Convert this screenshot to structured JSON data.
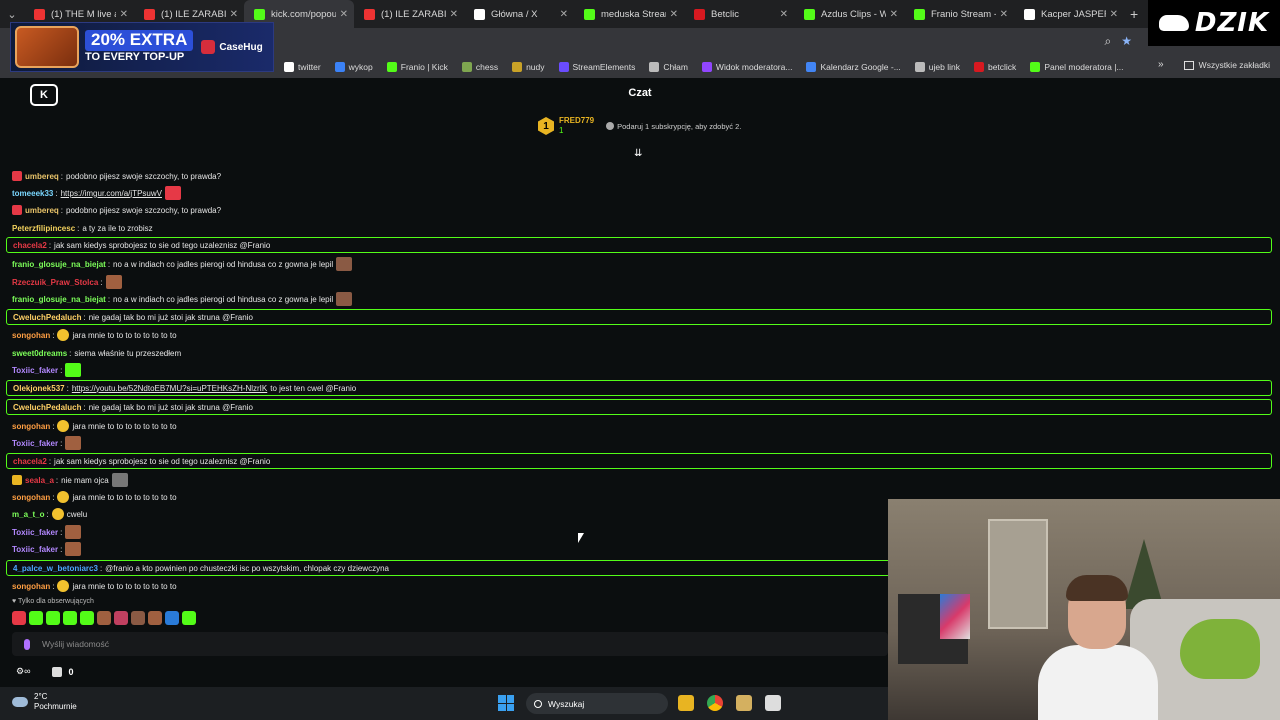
{
  "browser": {
    "tabs": [
      {
        "label": "(1) THE M live at R",
        "color": "#e33"
      },
      {
        "label": "(1) ILE ZARABIA K",
        "color": "#e33"
      },
      {
        "label": "kick.com/popout/",
        "color": "#53fc18",
        "active": true
      },
      {
        "label": "(1) ILE ZARABIA K",
        "color": "#e33"
      },
      {
        "label": "Główna / X",
        "color": "#fff"
      },
      {
        "label": "meduska Stream",
        "color": "#53fc18"
      },
      {
        "label": "Betclic",
        "color": "#d71920"
      },
      {
        "label": "Azdus Clips - Wat",
        "color": "#53fc18"
      },
      {
        "label": "Franio Stream - W",
        "color": "#53fc18"
      },
      {
        "label": "Kacper JASPER P",
        "color": "#fff"
      }
    ],
    "close_glyph": "✕",
    "new_tab_glyph": "+",
    "bookmarks": [
      {
        "label": "twitter",
        "color": "#fff"
      },
      {
        "label": "wykop",
        "color": "#3b82f6"
      },
      {
        "label": "Franio | Kick",
        "color": "#53fc18"
      },
      {
        "label": "chess",
        "color": "#7fa650"
      },
      {
        "label": "nudy",
        "color": "#c9a227"
      },
      {
        "label": "StreamElements",
        "color": "#6a4cff"
      },
      {
        "label": "Chłam",
        "color": "#bbb"
      },
      {
        "label": "Widok moderatora...",
        "color": "#9146ff"
      },
      {
        "label": "Kalendarz Google -...",
        "color": "#4285f4"
      },
      {
        "label": "ujeb link",
        "color": "#bbb"
      },
      {
        "label": "betclick",
        "color": "#d71920"
      },
      {
        "label": "Panel moderatora |...",
        "color": "#53fc18"
      }
    ],
    "all_bookmarks": "Wszystkie zakładki"
  },
  "ad": {
    "headline": "20% EXTRA",
    "subline": "TO EVERY TOP-UP",
    "brand": "CaseHug"
  },
  "overlay_logo": "DZIK",
  "chat": {
    "title": "Czat",
    "pinned": {
      "rank": "1",
      "name": "FRED779",
      "count": "1",
      "gift_text": "Podaruj 1 subskrypcję, aby zdobyć 2."
    },
    "messages": [
      {
        "user": "umbereq",
        "color": "#e9c46a",
        "text": "podobno pijesz swoje szczochy, to prawda?",
        "badge": "#e63946"
      },
      {
        "user": "tomeeek33",
        "color": "#7ad7ff",
        "text": "https://imgur.com/a/jTPsuwV",
        "link": true,
        "emote": "#e63946"
      },
      {
        "user": "umbereq",
        "color": "#e9c46a",
        "text": "podobno pijesz swoje szczochy, to prawda?",
        "badge": "#e63946"
      },
      {
        "user": "Peterzfilipincesc",
        "color": "#f4d35e",
        "text": "a ty za ile to zrobisz"
      },
      {
        "user": "chacela2",
        "color": "#e63946",
        "text": "jak sam kiedys sprobojesz to sie od tego uzaleznisz @Franio",
        "hl": true
      },
      {
        "user": "franio_glosuje_na_biejat",
        "color": "#7dff5a",
        "text": "no a w indiach co jadles pierogi od hindusa co z gowna je lepil",
        "emote": "#8a5a44"
      },
      {
        "user": "Rzeczuik_Praw_Stolca",
        "color": "#e63946",
        "text": "",
        "emote": "#a06040"
      },
      {
        "user": "franio_glosuje_na_biejat",
        "color": "#7dff5a",
        "text": "no a w indiach co jadles pierogi od hindusa co z gowna je lepil",
        "emote": "#8a5a44"
      },
      {
        "user": "CweluchPedaluch",
        "color": "#ffd166",
        "text": "nie gadaj tak bo mi już stoi jak struna @Franio",
        "hl": true
      },
      {
        "user": "songohan",
        "color": "#ff9f43",
        "text": "jara mnie to to to to to to to to",
        "smile": true
      },
      {
        "user": "sweet0dreams",
        "color": "#7dff5a",
        "text": "siema właśnie tu przeszedłem"
      },
      {
        "user": "Toxiic_faker",
        "color": "#b388ff",
        "text": "",
        "emote": "#53fc18"
      },
      {
        "user": "Olekjonek537",
        "color": "#ffd166",
        "text": "https://youtu.be/52NdtoEB7MU?si=uPTEHKsZH-NlzrIK",
        "link": true,
        "after": "to jest ten cwel @Franio",
        "hl": true
      },
      {
        "user": "CweluchPedaluch",
        "color": "#ffd166",
        "text": "nie gadaj tak bo mi już stoi jak struna @Franio",
        "hl": true
      },
      {
        "user": "songohan",
        "color": "#ff9f43",
        "text": "jara mnie to to to to to to to to",
        "smile": true
      },
      {
        "user": "Toxiic_faker",
        "color": "#b388ff",
        "text": "",
        "emote": "#a06040"
      },
      {
        "user": "chacela2",
        "color": "#e63946",
        "text": "jak sam kiedys sprobojesz to sie od tego uzaleznisz @Franio",
        "hl": true
      },
      {
        "user": "seala_a",
        "color": "#e63946",
        "text": "nie mam ojca",
        "badge": "#e8b422",
        "emote": "#777"
      },
      {
        "user": "songohan",
        "color": "#ff9f43",
        "text": "jara mnie to to to to to to to to",
        "smile": true
      },
      {
        "user": "m_a_t_o",
        "color": "#7dff5a",
        "text": "cwelu",
        "smile": true
      },
      {
        "user": "Toxiic_faker",
        "color": "#b388ff",
        "text": "",
        "emote": "#a06040"
      },
      {
        "user": "Toxiic_faker",
        "color": "#b388ff",
        "text": "",
        "emote": "#a06040"
      },
      {
        "user": "4_palce_w_betoniarc3",
        "color": "#4ea8ff",
        "text": "@franio a kto powinien po chusteczki isc po wszytskim, chlopak czy dziewczyna",
        "hl": true
      },
      {
        "user": "songohan",
        "color": "#ff9f43",
        "text": "jara mnie to to to to to to to to",
        "smile": true
      }
    ],
    "followers_only": "♥ Tylko dla obserwujących",
    "input_placeholder": "Wyślij wiadomość",
    "points": "0"
  },
  "taskbar": {
    "temp": "2°C",
    "weather": "Pochmurnie",
    "search": "Wyszukaj"
  }
}
